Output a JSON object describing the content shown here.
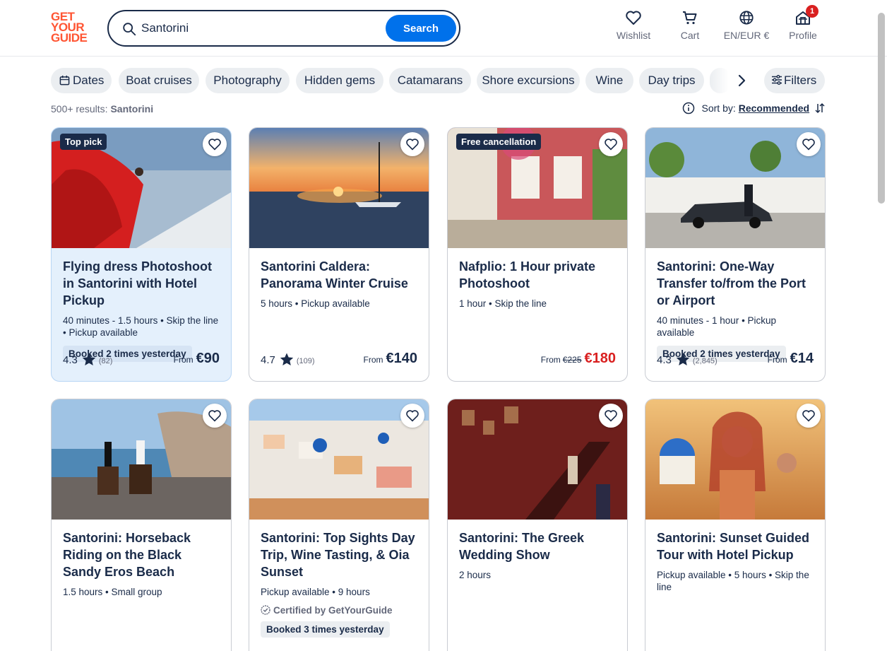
{
  "brand": {
    "line1": "GET",
    "line2": "YOUR",
    "line3": "GUIDE"
  },
  "search": {
    "value": "Santorini",
    "button": "Search"
  },
  "nav": {
    "wishlist": "Wishlist",
    "cart": "Cart",
    "locale": "EN/EUR €",
    "profile": "Profile",
    "profile_badge": "1"
  },
  "chips": [
    "Dates",
    "Boat cruises",
    "Photography",
    "Hidden gems",
    "Catamarans",
    "Shore excursions",
    "Wine",
    "Day trips"
  ],
  "filters_label": "Filters",
  "results": {
    "count": "500+ results:",
    "query": "Santorini"
  },
  "sort": {
    "label": "Sort by:",
    "value": "Recommended"
  },
  "cards": [
    {
      "tag": "Top pick",
      "title": "Flying dress Photoshoot in Santorini with Hotel Pickup",
      "meta": "40 minutes - 1.5 hours • Skip the line • Pickup available",
      "booked": "Booked 2 times yesterday",
      "rating": "4.3",
      "reviews": "(82)",
      "from": "From",
      "price": "€90"
    },
    {
      "title": "Santorini Caldera: Panorama Winter Cruise",
      "meta": "5 hours • Pickup available",
      "rating": "4.7",
      "reviews": "(109)",
      "from": "From",
      "price": "€140"
    },
    {
      "tag": "Free cancellation",
      "title": "Nafplio: 1 Hour private Photoshoot",
      "meta": "1 hour • Skip the line",
      "from": "From",
      "old_price": "€225",
      "price": "€180"
    },
    {
      "title": "Santorini: One-Way Transfer to/from the Port or Airport",
      "meta": "40 minutes - 1 hour • Pickup available",
      "booked": "Booked 2 times yesterday",
      "rating": "4.3",
      "reviews": "(2,845)",
      "from": "From",
      "price": "€14"
    },
    {
      "title": "Santorini: Horseback Riding on the Black Sandy Eros Beach",
      "meta": "1.5 hours • Small group"
    },
    {
      "title": "Santorini: Top Sights Day Trip, Wine Tasting, & Oia Sunset",
      "meta": "Pickup available • 9 hours",
      "certified": "Certified by GetYourGuide",
      "booked": "Booked 3 times yesterday"
    },
    {
      "title": "Santorini: The Greek Wedding Show",
      "meta": "2 hours"
    },
    {
      "title": "Santorini: Sunset Guided Tour with Hotel Pickup",
      "meta": "Pickup available • 5 hours • Skip the line"
    }
  ],
  "colors": {
    "accent": "#0071eb",
    "brand": "#ff5533",
    "text": "#1a2b49",
    "sale": "#d92020",
    "chip": "#ebeef1"
  }
}
